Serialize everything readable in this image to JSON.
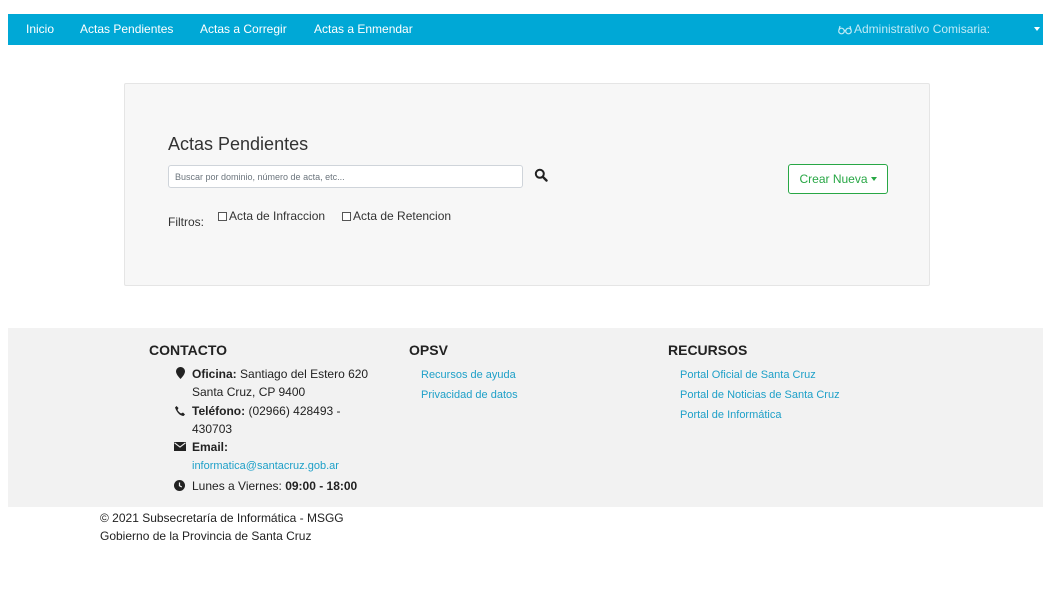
{
  "nav": {
    "items": [
      "Inicio",
      "Actas Pendientes",
      "Actas a Corregir",
      "Actas a Enmendar"
    ],
    "user_label": "Administrativo Comisaria:",
    "user_icon": "glasses-icon",
    "bg_color": "#00a8d6"
  },
  "main": {
    "title": "Actas Pendientes",
    "search_placeholder": "Buscar por dominio, número de acta, etc...",
    "search_value": "",
    "filters_label": "Filtros:",
    "filters": [
      "Acta de Infraccion",
      "Acta de Retencion"
    ],
    "create_button": "Crear Nueva",
    "accent_color": "#28a745"
  },
  "footer": {
    "contact": {
      "title": "CONTACTO",
      "office_label": "Oficina:",
      "office_value": "Santiago del Estero 620",
      "office_city": "Santa Cruz, CP 9400",
      "phone_label": "Teléfono:",
      "phone_value": "(02966) 428493 -",
      "phone_value2": "430703",
      "email_label": "Email:",
      "email_value": "informatica@santacruz.gob.ar",
      "hours_label": "Lunes a Viernes:",
      "hours_value": "09:00 - 18:00"
    },
    "opsv": {
      "title": "OPSV",
      "links": [
        "Recursos de ayuda",
        "Privacidad de datos"
      ]
    },
    "recursos": {
      "title": "RECURSOS",
      "links": [
        "Portal Oficial de Santa Cruz",
        "Portal de Noticias de Santa Cruz",
        "Portal de Informática"
      ]
    },
    "link_color": "#1ea0c8"
  },
  "copyright": {
    "line1": "© 2021 Subsecretaría de Informática - MSGG",
    "line2": "Gobierno de la Provincia de Santa Cruz"
  }
}
